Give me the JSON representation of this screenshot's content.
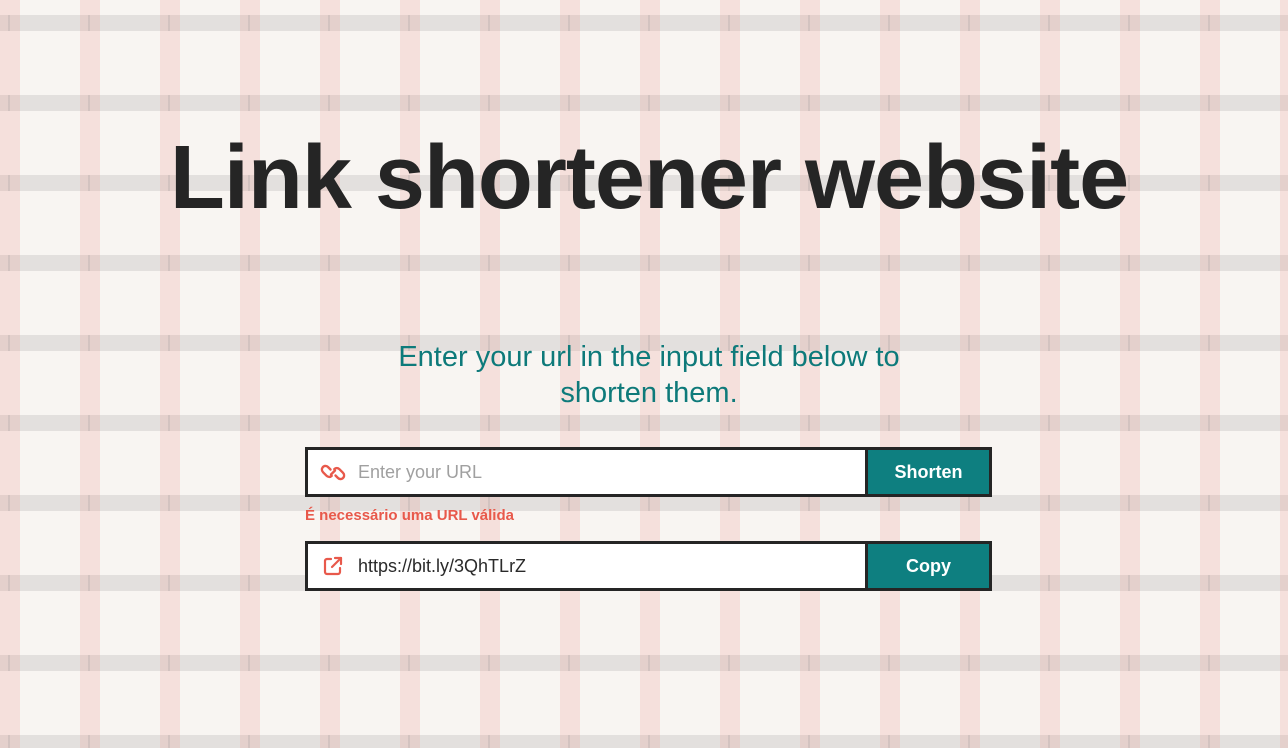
{
  "header": {
    "title": "Link shortener website",
    "subtitle_line1": "Enter your url in the input field below to",
    "subtitle_line2": "shorten them."
  },
  "shorten_form": {
    "placeholder": "Enter your URL",
    "value": "",
    "button_label": "Shorten",
    "icon": "link-icon",
    "error_message": "É necessário uma URL válida"
  },
  "result": {
    "short_url": "https://bit.ly/3QhTLrZ",
    "button_label": "Copy",
    "icon": "external-link-icon"
  },
  "colors": {
    "background": "#f8f5f2",
    "title": "#252525",
    "subtitle": "#0e7a7a",
    "accent": "#0e7f80",
    "error": "#e8594b",
    "icon": "#e8594b"
  }
}
